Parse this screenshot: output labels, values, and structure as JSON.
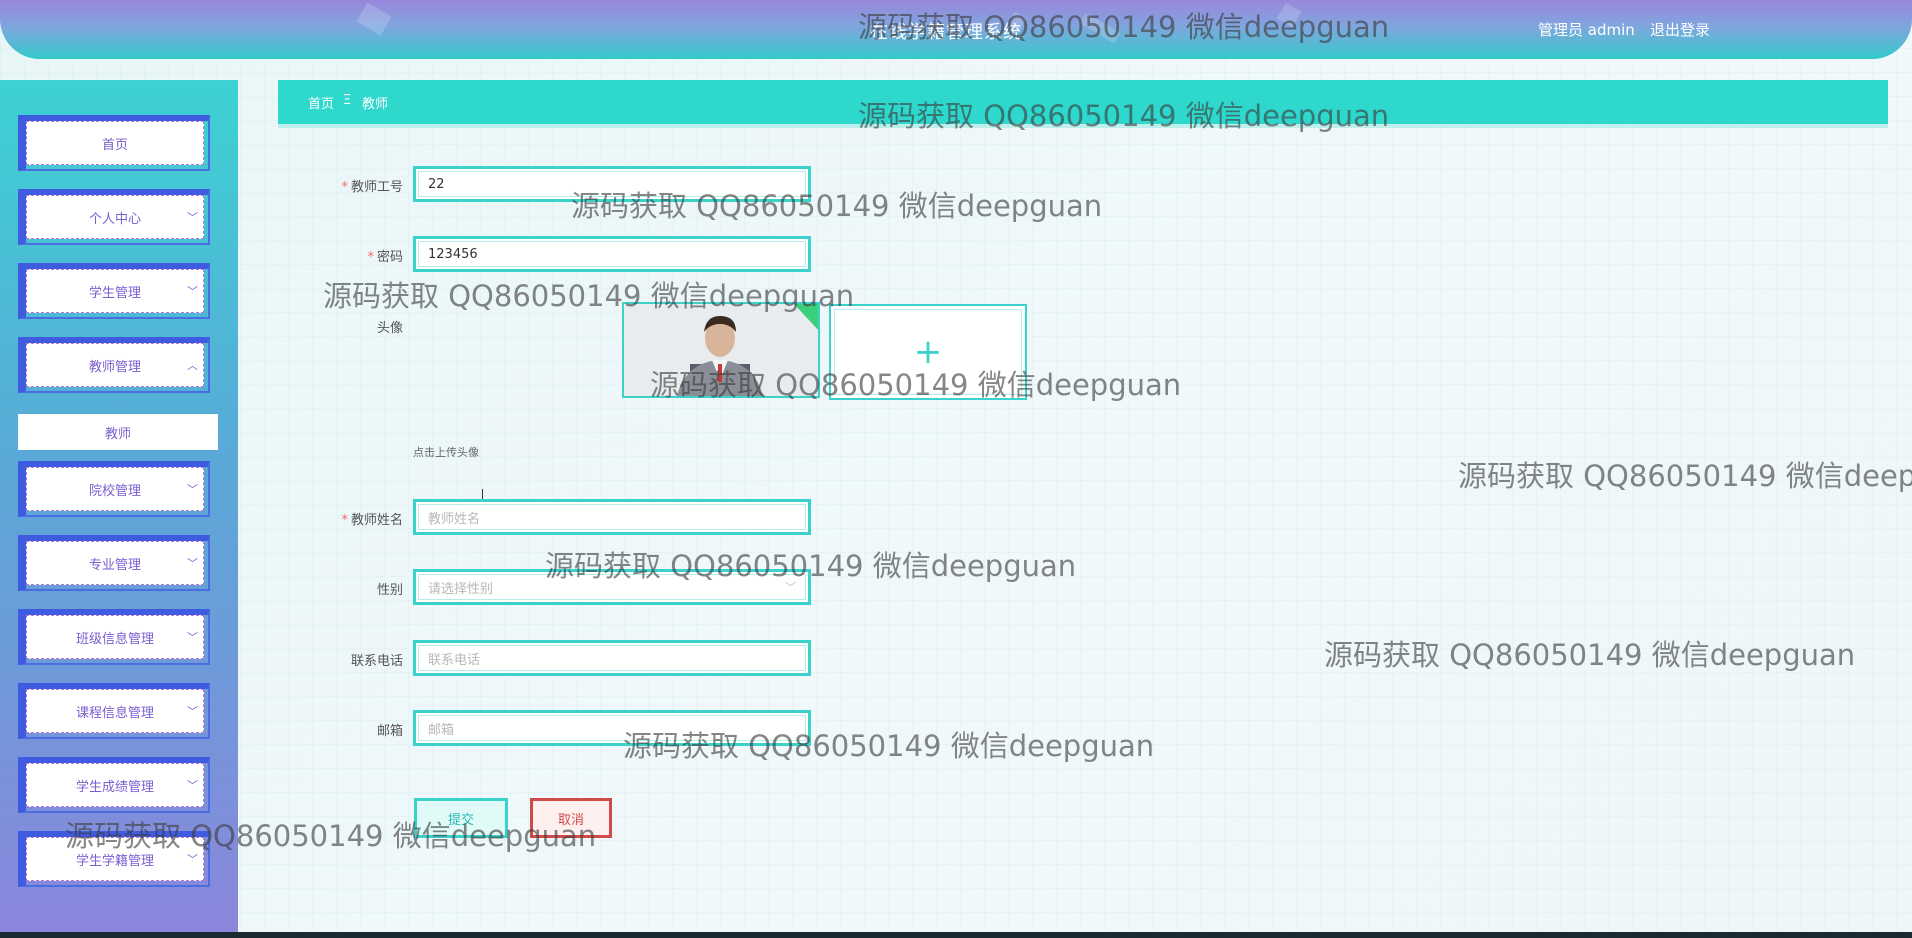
{
  "header": {
    "title": "在线学籍管理系统",
    "user_label": "管理员 admin",
    "logout_label": "退出登录"
  },
  "sidebar": {
    "items": [
      {
        "label": "首页",
        "chevron": ""
      },
      {
        "label": "个人中心",
        "chevron": "﹀"
      },
      {
        "label": "学生管理",
        "chevron": "﹀"
      },
      {
        "label": "教师管理",
        "chevron": "︿"
      },
      {
        "label": "院校管理",
        "chevron": "﹀"
      },
      {
        "label": "专业管理",
        "chevron": "﹀"
      },
      {
        "label": "班级信息管理",
        "chevron": "﹀"
      },
      {
        "label": "课程信息管理",
        "chevron": "﹀"
      },
      {
        "label": "学生成绩管理",
        "chevron": "﹀"
      },
      {
        "label": "学生学籍管理",
        "chevron": "﹀"
      }
    ],
    "submenu_label": "教师"
  },
  "breadcrumb": {
    "home": "首页",
    "separator": "Ξ",
    "current": "教师"
  },
  "form": {
    "teacher_id": {
      "label": "教师工号",
      "value": "22",
      "required": "*"
    },
    "password": {
      "label": "密码",
      "value": "123456",
      "required": "*"
    },
    "avatar": {
      "label": "头像",
      "upload_hint": "点击上传头像",
      "plus": "+"
    },
    "teacher_name": {
      "label": "教师姓名",
      "placeholder": "教师姓名",
      "required": "*"
    },
    "gender": {
      "label": "性别",
      "placeholder": "请选择性别",
      "chevron": "﹀"
    },
    "phone": {
      "label": "联系电话",
      "placeholder": "联系电话"
    },
    "email": {
      "label": "邮箱",
      "placeholder": "邮箱"
    },
    "submit_label": "提交",
    "cancel_label": "取消"
  },
  "watermark": {
    "text": "源码获取 QQ86050149 微信deepguan",
    "text_truncated": "源码获取 QQ86050149 微信deep"
  },
  "colors": {
    "accent": "#2ed8cc",
    "menu_text": "#7b5ed0",
    "cancel": "#d14a4a"
  }
}
